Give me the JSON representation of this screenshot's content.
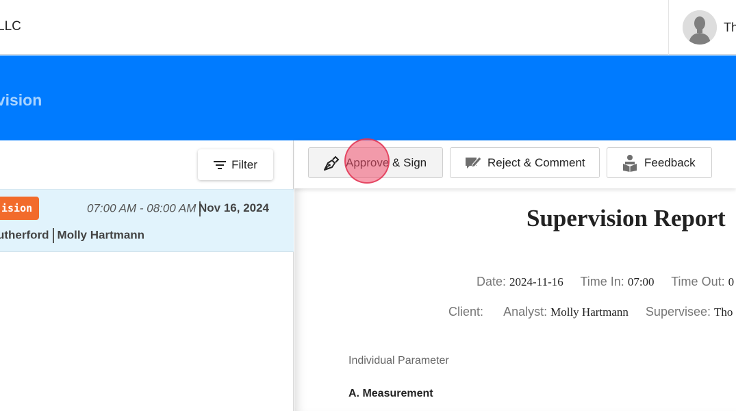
{
  "header": {
    "org_name": "LLC",
    "user_name": "Th",
    "avatar_icon": "user-avatar-icon"
  },
  "banner": {
    "title": "evision",
    "bg_color": "#007bff"
  },
  "left_panel": {
    "filter_label": "Filter",
    "session": {
      "badge": "ision",
      "time_range": "07:00 AM - 08:00 AM",
      "date": "Nov 16, 2024",
      "client": "utherford",
      "analyst": "Molly Hartmann"
    }
  },
  "toolbar": {
    "approve_label": "Approve & Sign",
    "reject_label": "Reject & Comment",
    "feedback_label": "Feedback"
  },
  "report": {
    "title": "Supervision Report",
    "date_label": "Date:",
    "date_value": "2024-11-16",
    "time_in_label": "Time In:",
    "time_in_value": "07:00",
    "time_out_label": "Time Out:",
    "time_out_value": "0",
    "client_label": "Client:",
    "client_value": "",
    "analyst_label": "Analyst:",
    "analyst_value": "Molly Hartmann",
    "supervisee_label": "Supervisee:",
    "supervisee_value": "Tho",
    "section_label": "Individual Parameter",
    "section_heading": "A. Measurement"
  },
  "colors": {
    "accent": "#007bff",
    "badge": "#f26b2b",
    "selected_row": "#e1f3fc"
  }
}
